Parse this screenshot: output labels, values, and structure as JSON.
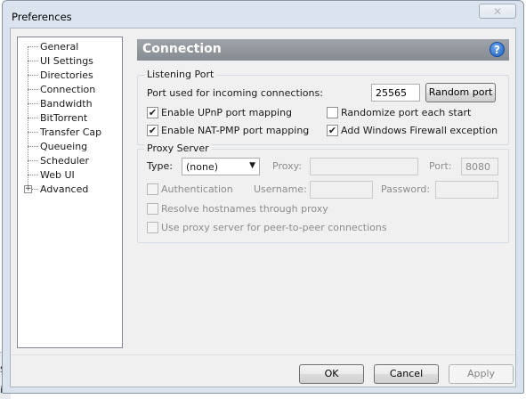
{
  "window": {
    "title": "Preferences"
  },
  "background": {
    "fragment_top": "Se",
    "fragment_bottom": "in"
  },
  "sidebar": {
    "items": [
      {
        "label": "General",
        "expandable": false
      },
      {
        "label": "UI Settings",
        "expandable": false
      },
      {
        "label": "Directories",
        "expandable": false
      },
      {
        "label": "Connection",
        "expandable": false,
        "selected": true
      },
      {
        "label": "Bandwidth",
        "expandable": false
      },
      {
        "label": "BitTorrent",
        "expandable": false
      },
      {
        "label": "Transfer Cap",
        "expandable": false
      },
      {
        "label": "Queueing",
        "expandable": false
      },
      {
        "label": "Scheduler",
        "expandable": false
      },
      {
        "label": "Web UI",
        "expandable": false
      },
      {
        "label": "Advanced",
        "expandable": true,
        "expander_symbol": "+"
      }
    ]
  },
  "header": {
    "title": "Connection",
    "help_icon_glyph": "?"
  },
  "listening_port": {
    "group_title": "Listening Port",
    "port_label": "Port used for incoming connections:",
    "port_value": "25565",
    "random_port_button": "Random port",
    "checkboxes": {
      "upnp": {
        "label": "Enable UPnP port mapping",
        "checked": true
      },
      "randomize": {
        "label": "Randomize port each start",
        "checked": false
      },
      "natpmp": {
        "label": "Enable NAT-PMP port mapping",
        "checked": true
      },
      "firewall": {
        "label": "Add Windows Firewall exception",
        "checked": true
      }
    }
  },
  "proxy_server": {
    "group_title": "Proxy Server",
    "type_label": "Type:",
    "type_value": "(none)",
    "proxy_label": "Proxy:",
    "proxy_value": "",
    "port_label": "Port:",
    "port_value": "8080",
    "authentication_label": "Authentication",
    "username_label": "Username:",
    "username_value": "",
    "password_label": "Password:",
    "password_value": "",
    "resolve_hostnames_label": "Resolve hostnames through proxy",
    "peer_proxy_label": "Use proxy server for peer-to-peer connections"
  },
  "buttons": {
    "ok": "OK",
    "cancel": "Cancel",
    "apply": "Apply"
  },
  "colors": {
    "header_bg": "#8e939a",
    "window_frame": "#dbe4ee",
    "help_icon": "#1d5fc3"
  }
}
